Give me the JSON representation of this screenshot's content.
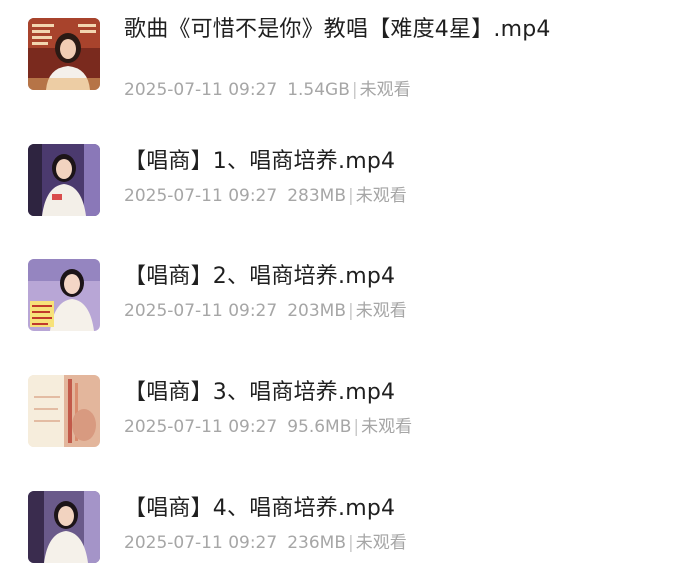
{
  "files": [
    {
      "name": "歌曲《可惜不是你》教唱【难度4星】.mp4",
      "date": "2025-07-11 09:27",
      "size": "1.54GB",
      "status": "未观看",
      "thumb_icon": "video-thumbnail-icon"
    },
    {
      "name": "【唱商】1、唱商培养.mp4",
      "date": "2025-07-11 09:27",
      "size": "283MB",
      "status": "未观看",
      "thumb_icon": "video-thumbnail-icon"
    },
    {
      "name": "【唱商】2、唱商培养.mp4",
      "date": "2025-07-11 09:27",
      "size": "203MB",
      "status": "未观看",
      "thumb_icon": "video-thumbnail-icon"
    },
    {
      "name": "【唱商】3、唱商培养.mp4",
      "date": "2025-07-11 09:27",
      "size": "95.6MB",
      "status": "未观看",
      "thumb_icon": "video-thumbnail-icon"
    },
    {
      "name": "【唱商】4、唱商培养.mp4",
      "date": "2025-07-11 09:27",
      "size": "236MB",
      "status": "未观看",
      "thumb_icon": "video-thumbnail-icon"
    }
  ],
  "separator": "|"
}
